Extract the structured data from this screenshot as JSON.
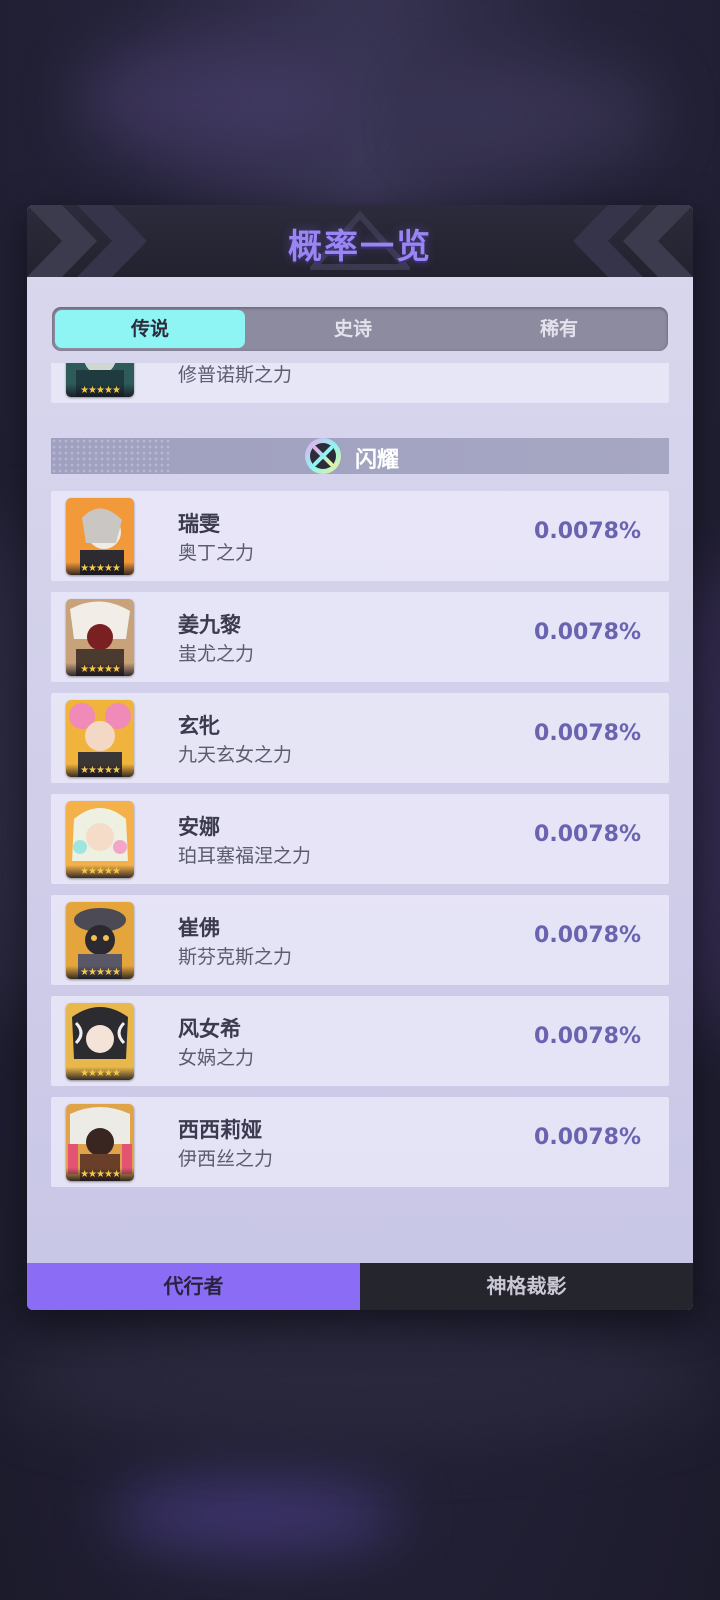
{
  "dialog": {
    "title": "概率一览",
    "rarity_tabs": [
      {
        "label": "传说",
        "active": true
      },
      {
        "label": "史诗",
        "active": false
      },
      {
        "label": "稀有",
        "active": false
      }
    ],
    "partial_row": {
      "subtitle": "修普诺斯之力"
    },
    "section": {
      "label": "闪耀"
    },
    "entries": [
      {
        "name": "瑞雯",
        "subtitle": "奥丁之力",
        "probability": "0.0078%"
      },
      {
        "name": "姜九黎",
        "subtitle": "蚩尤之力",
        "probability": "0.0078%"
      },
      {
        "name": "玄牝",
        "subtitle": "九天玄女之力",
        "probability": "0.0078%"
      },
      {
        "name": "安娜",
        "subtitle": "珀耳塞福涅之力",
        "probability": "0.0078%"
      },
      {
        "name": "崔佛",
        "subtitle": "斯芬克斯之力",
        "probability": "0.0078%"
      },
      {
        "name": "风女希",
        "subtitle": "女娲之力",
        "probability": "0.0078%"
      },
      {
        "name": "西西莉娅",
        "subtitle": "伊西丝之力",
        "probability": "0.0078%"
      }
    ],
    "bottom_tabs": [
      {
        "label": "代行者",
        "active": true
      },
      {
        "label": "神格裁影",
        "active": false
      }
    ]
  },
  "colors": {
    "title": "#9a86f2",
    "active_rarity_tab": "#8ef4f4",
    "active_bottom_tab": "#8b6cf5",
    "probability": "#6a64b0"
  }
}
